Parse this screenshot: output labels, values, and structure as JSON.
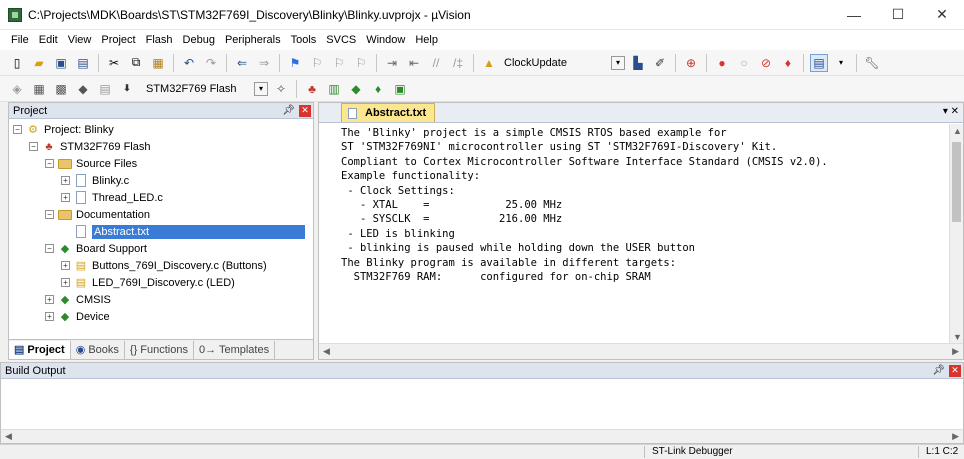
{
  "window": {
    "title": "C:\\Projects\\MDK\\Boards\\ST\\STM32F769I_Discovery\\Blinky\\Blinky.uvprojx - µVision"
  },
  "menu": [
    "File",
    "Edit",
    "View",
    "Project",
    "Flash",
    "Debug",
    "Peripherals",
    "Tools",
    "SVCS",
    "Window",
    "Help"
  ],
  "toolbar1": {
    "function_label": "ClockUpdate"
  },
  "toolbar2": {
    "target": "STM32F769 Flash"
  },
  "project_panel": {
    "title": "Project",
    "tree": [
      {
        "label": "Project: Blinky",
        "exp": "−"
      },
      {
        "label": "STM32F769 Flash",
        "exp": "−"
      },
      {
        "label": "Source Files",
        "exp": "−"
      },
      {
        "label": "Blinky.c",
        "exp": "+"
      },
      {
        "label": "Thread_LED.c",
        "exp": "+"
      },
      {
        "label": "Documentation",
        "exp": "−"
      },
      {
        "label": "Abstract.txt",
        "exp": ""
      },
      {
        "label": "Board Support",
        "exp": "−"
      },
      {
        "label": "Buttons_769I_Discovery.c (Buttons)",
        "exp": "+"
      },
      {
        "label": "LED_769I_Discovery.c (LED)",
        "exp": "+"
      },
      {
        "label": "CMSIS",
        "exp": "+"
      },
      {
        "label": "Device",
        "exp": "+"
      }
    ],
    "tabs": [
      "Project",
      "Books",
      "{} Functions",
      "0→ Templates"
    ]
  },
  "editor": {
    "tab": "Abstract.txt",
    "lines": [
      "The 'Blinky' project is a simple CMSIS RTOS based example for",
      "ST 'STM32F769NI' microcontroller using ST 'STM32F769I-Discovery' Kit.",
      "Compliant to Cortex Microcontroller Software Interface Standard (CMSIS v2.0).",
      "",
      "Example functionality:",
      " - Clock Settings:",
      "   - XTAL    =            25.00 MHz",
      "   - SYSCLK  =           216.00 MHz",
      "",
      " - LED is blinking",
      " - blinking is paused while holding down the USER button",
      "",
      "",
      "The Blinky program is available in different targets:",
      "",
      "  STM32F769 RAM:      configured for on-chip SRAM"
    ]
  },
  "build_output": {
    "title": "Build Output"
  },
  "status": {
    "debugger": "ST-Link Debugger",
    "position": "L:1 C:2"
  }
}
